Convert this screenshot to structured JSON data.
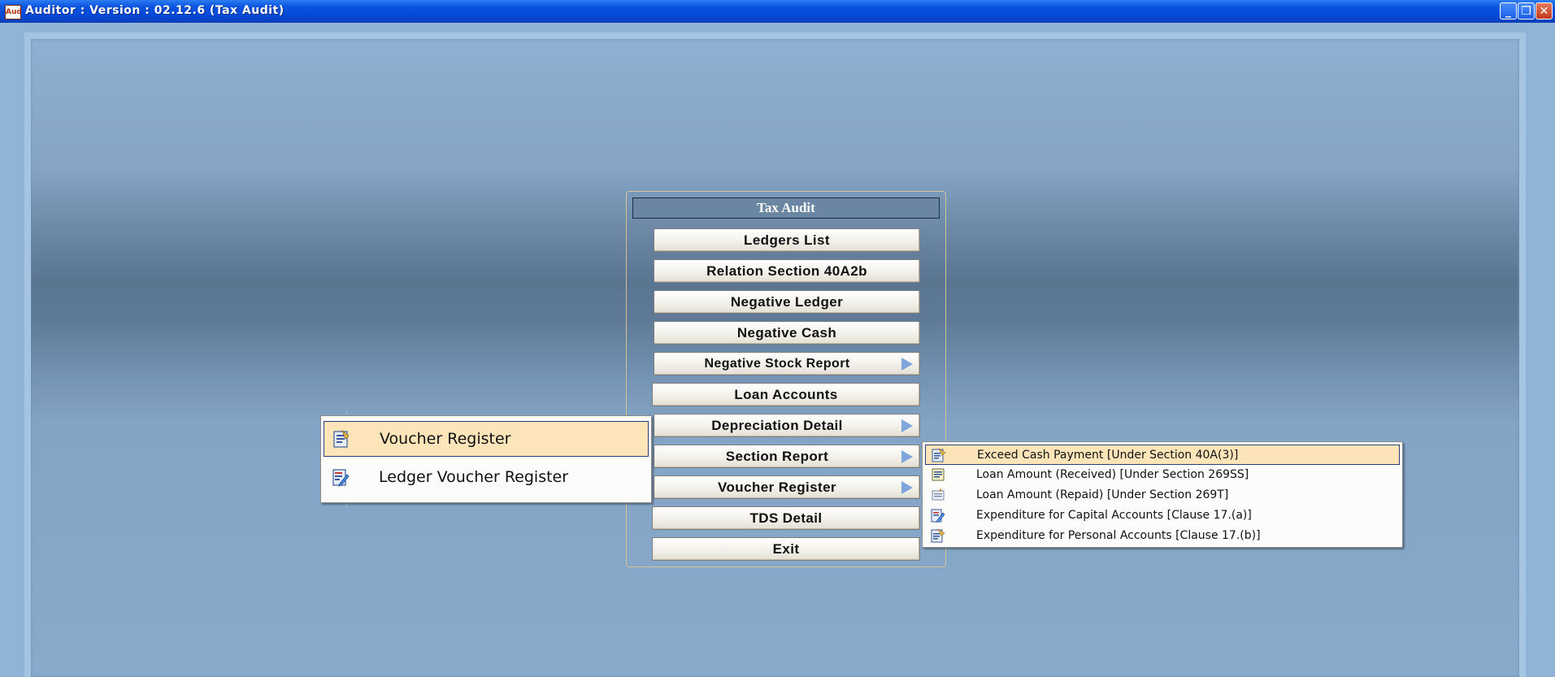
{
  "window": {
    "title": "Auditor : Version : 02.12.6 (Tax Audit)",
    "icon_text": "Aud",
    "controls": {
      "minimize": "_",
      "maximize": "❐",
      "close": "✕"
    }
  },
  "panel": {
    "header": "Tax Audit",
    "buttons": [
      {
        "label": "Ledgers List",
        "has_submenu": false
      },
      {
        "label": "Relation Section 40A2b",
        "has_submenu": false
      },
      {
        "label": "Negative Ledger",
        "has_submenu": false
      },
      {
        "label": "Negative Cash",
        "has_submenu": false
      },
      {
        "label": "Negative Stock Report",
        "has_submenu": true
      },
      {
        "label": "Loan Accounts",
        "has_submenu": false
      },
      {
        "label": "Depreciation Detail",
        "has_submenu": true
      },
      {
        "label": "Section  Report",
        "has_submenu": true
      },
      {
        "label": "Voucher Register",
        "has_submenu": true
      },
      {
        "label": "TDS Detail",
        "has_submenu": false
      },
      {
        "label": "Exit",
        "has_submenu": false
      }
    ]
  },
  "voucher_submenu": {
    "items": [
      {
        "label": "Voucher Register",
        "icon": "report-icon",
        "selected": true
      },
      {
        "label": "Ledger Voucher Register",
        "icon": "edit-document-icon",
        "selected": false
      }
    ]
  },
  "section_submenu": {
    "items": [
      {
        "label": "Exceed Cash Payment [Under Section 40A(3)]",
        "icon": "report-icon",
        "selected": true
      },
      {
        "label": "Loan Amount (Received) [Under Section 269SS]",
        "icon": "document-icon",
        "selected": false
      },
      {
        "label": "Loan Amount (Repaid) [Under Section 269T]",
        "icon": "list-icon",
        "selected": false
      },
      {
        "label": "Expenditure for Capital Accounts [Clause  17.(a)]",
        "icon": "edit-document-icon",
        "selected": false
      },
      {
        "label": "Expenditure for Personal Accounts [Clause 17.(b)]",
        "icon": "report-icon",
        "selected": false
      }
    ]
  },
  "colors": {
    "titlebar": "#0548d6",
    "background": "#8fb4d8",
    "selected_item": "#fde5b9",
    "arrow": "#7fa6da"
  }
}
